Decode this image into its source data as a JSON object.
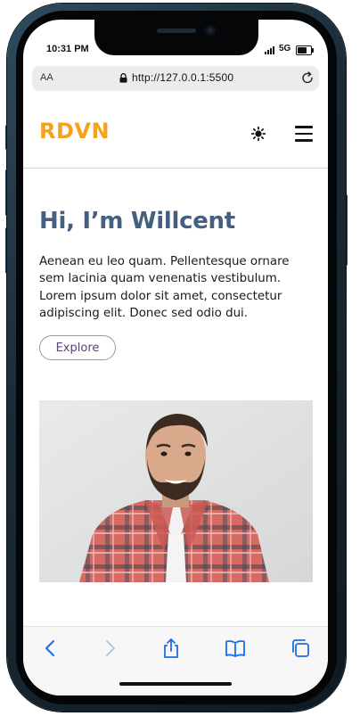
{
  "status_bar": {
    "time": "10:31 PM",
    "network": "5G",
    "battery_level": 0.85
  },
  "address_bar": {
    "text_size_label": "AA",
    "url": "http://127.0.0.1:5500"
  },
  "site": {
    "logo": "RDVN",
    "colors": {
      "logo": "#f4a31a",
      "title": "#45607f",
      "button_text": "#5a4374"
    },
    "icons": {
      "theme_toggle": "sun-icon",
      "menu": "hamburger-menu-icon"
    }
  },
  "hero": {
    "title": "Hi, I’m Willcent",
    "text": "Aenean eu leo quam. Pellentesque ornare sem lacinia quam venenatis vestibulum. Lorem ipsum dolor sit amet, consectetur adipiscing elit. Donec sed odio dui.",
    "button_label": "Explore",
    "image": "portrait-photo"
  },
  "toolbar": {
    "icons": [
      "back-arrow-icon",
      "forward-arrow-icon",
      "share-icon",
      "bookmarks-icon",
      "tabs-icon"
    ]
  }
}
